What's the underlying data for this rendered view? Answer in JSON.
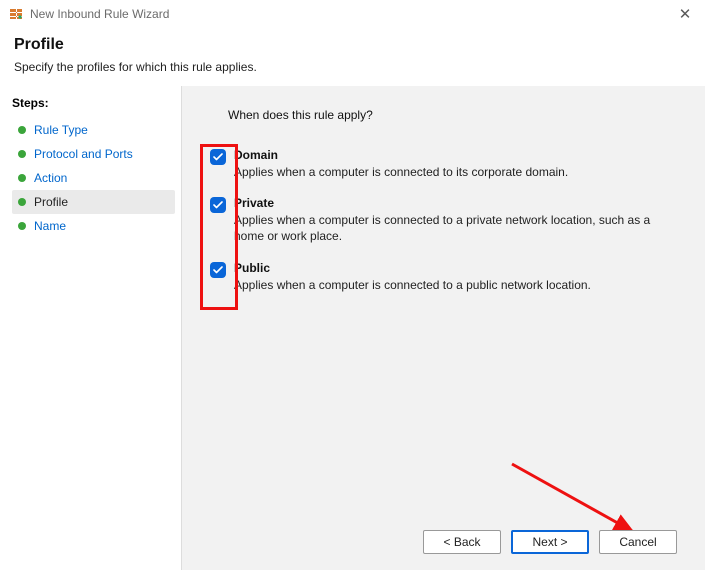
{
  "window": {
    "title": "New Inbound Rule Wizard"
  },
  "header": {
    "title": "Profile",
    "subtitle": "Specify the profiles for which this rule applies."
  },
  "sidebar": {
    "title": "Steps:",
    "items": [
      {
        "label": "Rule Type"
      },
      {
        "label": "Protocol and Ports"
      },
      {
        "label": "Action"
      },
      {
        "label": "Profile"
      },
      {
        "label": "Name"
      }
    ]
  },
  "content": {
    "question": "When does this rule apply?",
    "options": [
      {
        "label": "Domain",
        "desc": "Applies when a computer is connected to its corporate domain."
      },
      {
        "label": "Private",
        "desc": "Applies when a computer is connected to a private network location, such as a home or work place."
      },
      {
        "label": "Public",
        "desc": "Applies when a computer is connected to a public network location."
      }
    ]
  },
  "footer": {
    "back": "< Back",
    "next": "Next >",
    "cancel": "Cancel"
  }
}
